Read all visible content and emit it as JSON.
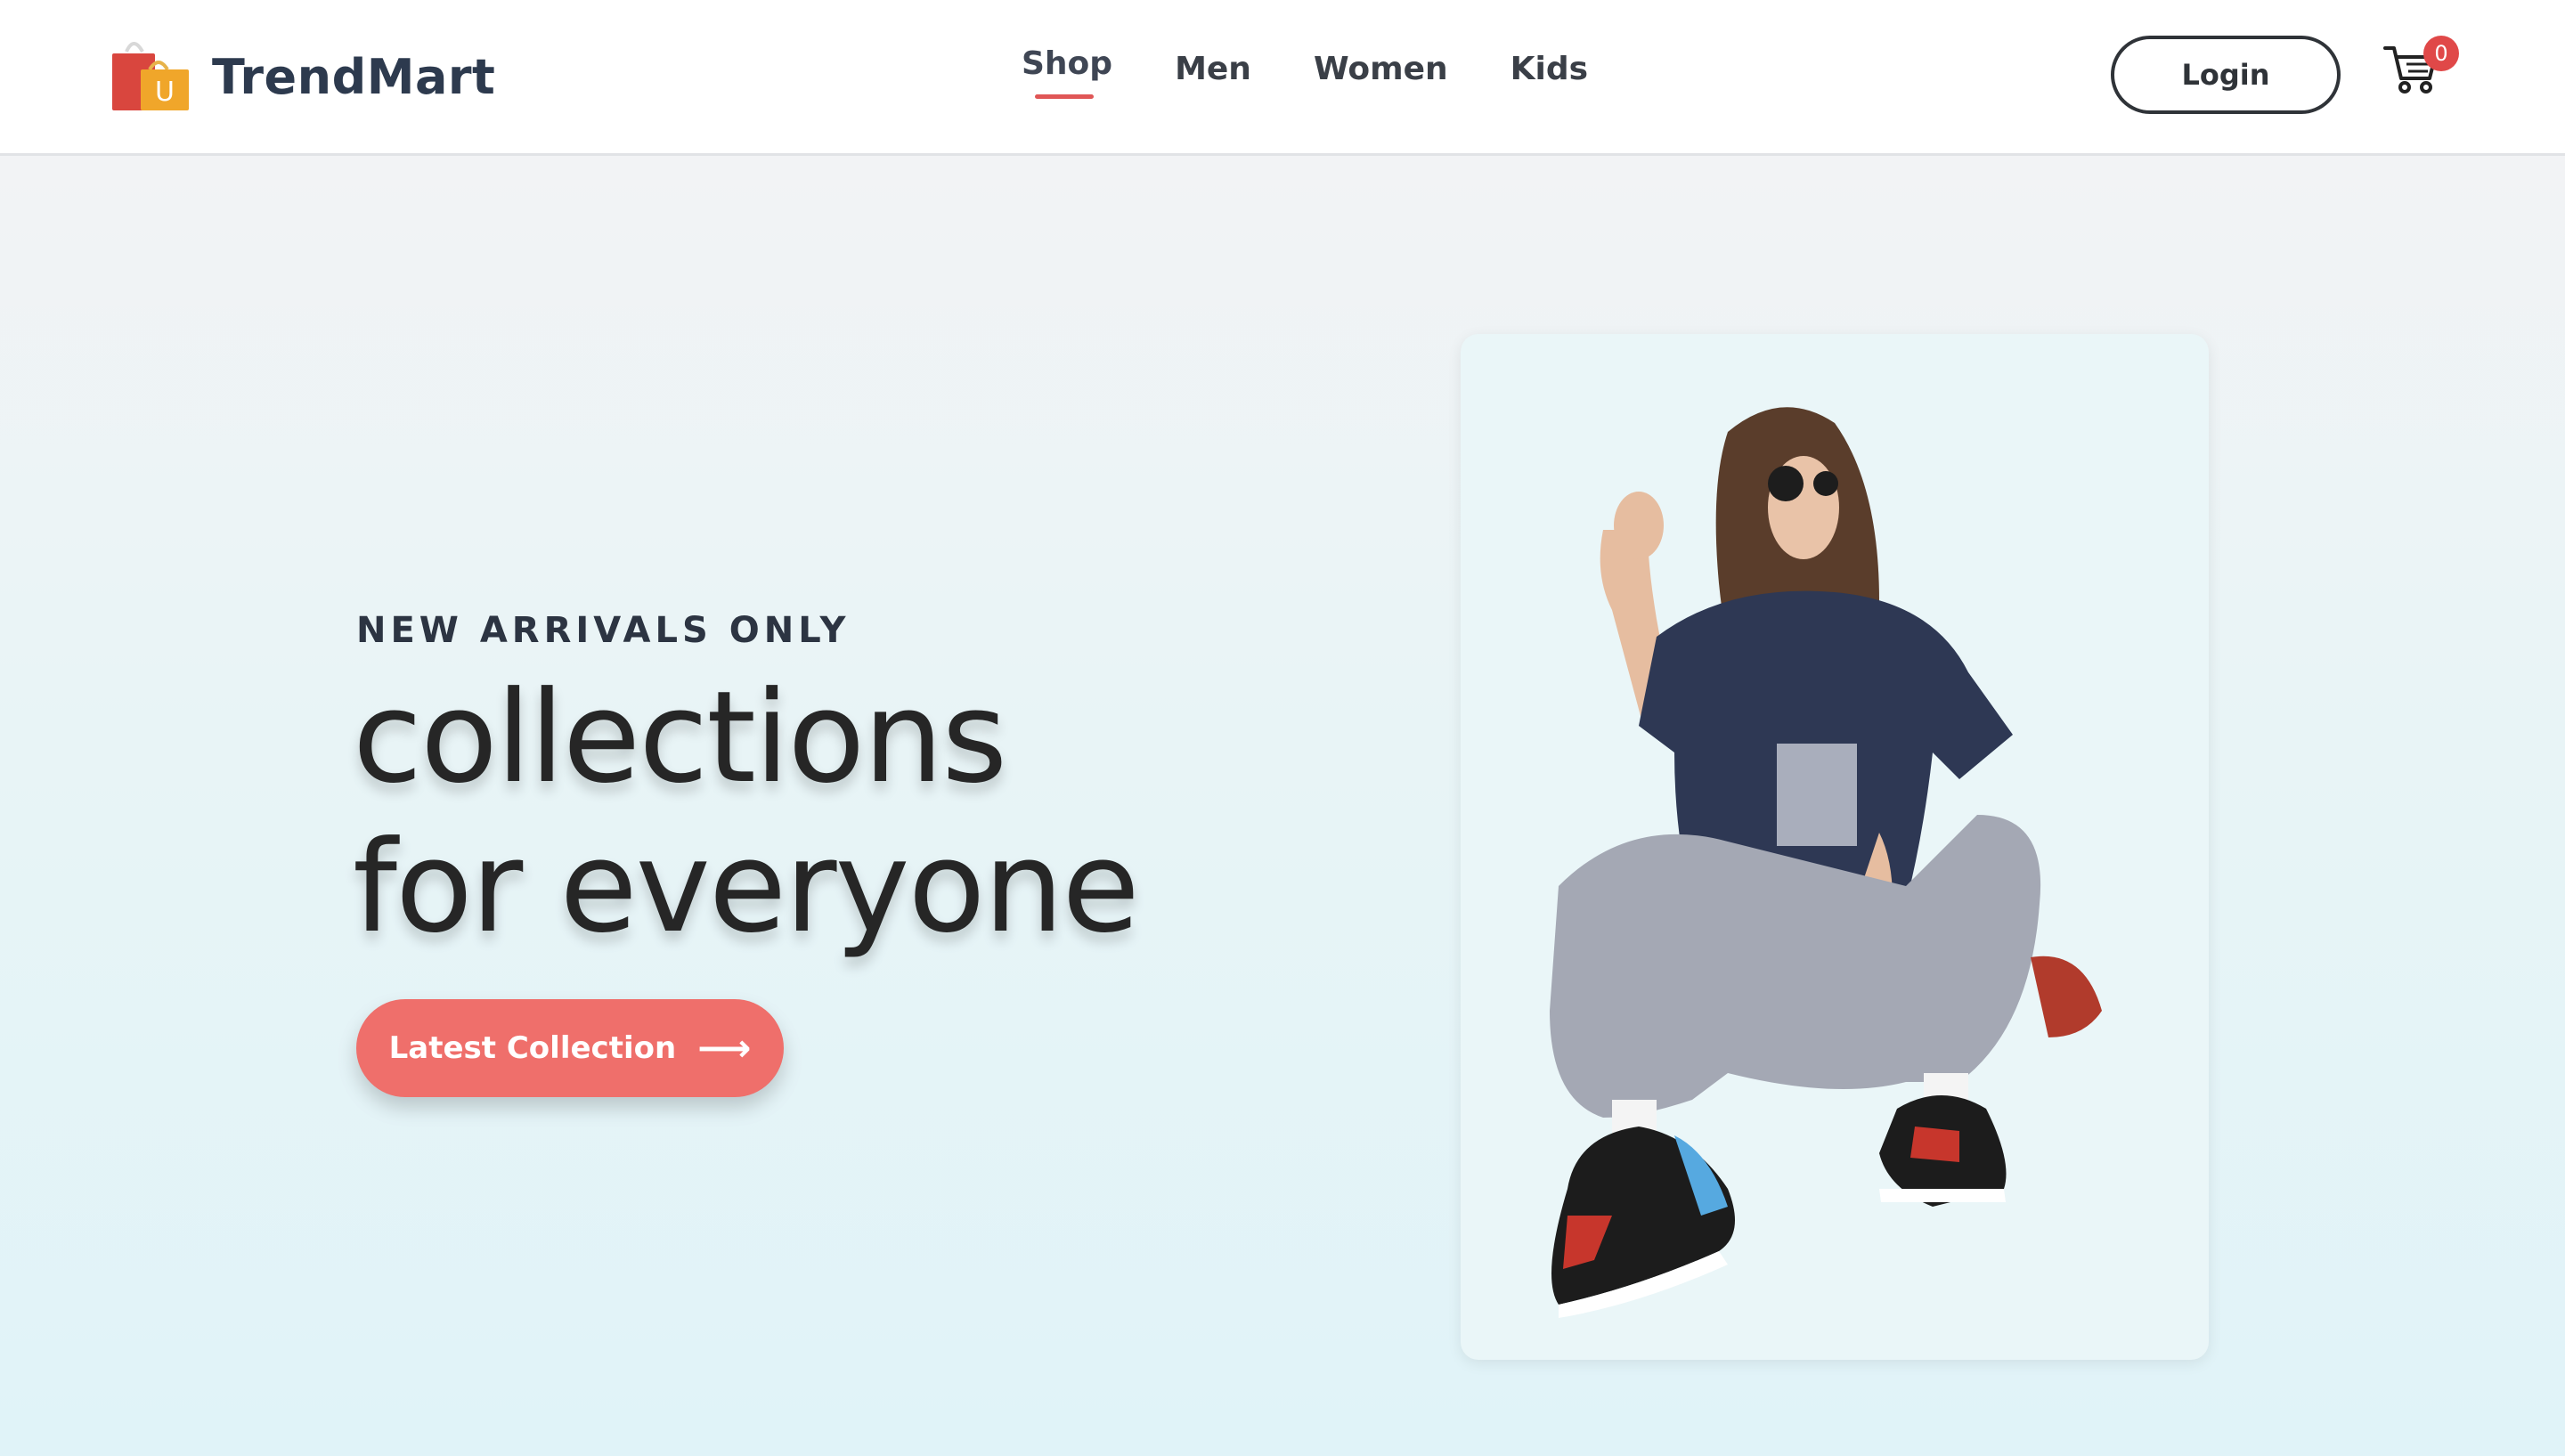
{
  "brand": {
    "name": "TrendMart",
    "logo_icon": "shopping-bags-icon",
    "logo_letter": "U"
  },
  "nav": {
    "items": [
      {
        "label": "Shop",
        "active": true
      },
      {
        "label": "Men"
      },
      {
        "label": "Women"
      },
      {
        "label": "Kids"
      }
    ]
  },
  "header": {
    "login_label": "Login",
    "cart_icon": "cart-icon",
    "cart_count": "0"
  },
  "hero": {
    "eyebrow": "NEW ARRIVALS ONLY",
    "headline_line1": "collections",
    "headline_line2": "for everyone",
    "cta_label": "Latest Collection",
    "cta_icon": "arrow-right-icon",
    "image_subject": "woman-in-streetwear"
  },
  "colors": {
    "accent": "#ef6f6b",
    "nav_underline": "#e05656",
    "badge": "#e04848",
    "text_dark": "#262626"
  }
}
